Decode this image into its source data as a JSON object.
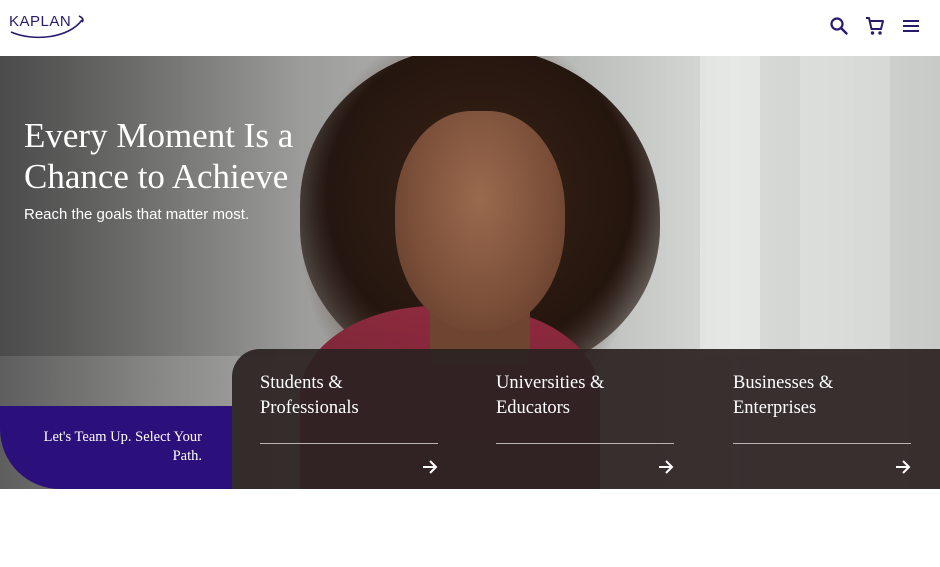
{
  "brand": {
    "logo_text": "KAPLAN",
    "primary_color": "#2b0f7a",
    "icon_color": "#2a1a6e"
  },
  "header": {
    "icons": [
      "search-icon",
      "cart-icon",
      "menu-icon"
    ]
  },
  "hero": {
    "title": "Every Moment Is a Chance to Achieve",
    "subtitle": "Reach the goals that matter most."
  },
  "teamup": {
    "label": "Let's Team Up. Select Your Path."
  },
  "paths": [
    {
      "label": "Students & Professionals",
      "icon": "arrow-right-icon"
    },
    {
      "label": "Universities & Educators",
      "icon": "arrow-right-icon"
    },
    {
      "label": "Businesses & Enterprises",
      "icon": "arrow-right-icon"
    }
  ]
}
